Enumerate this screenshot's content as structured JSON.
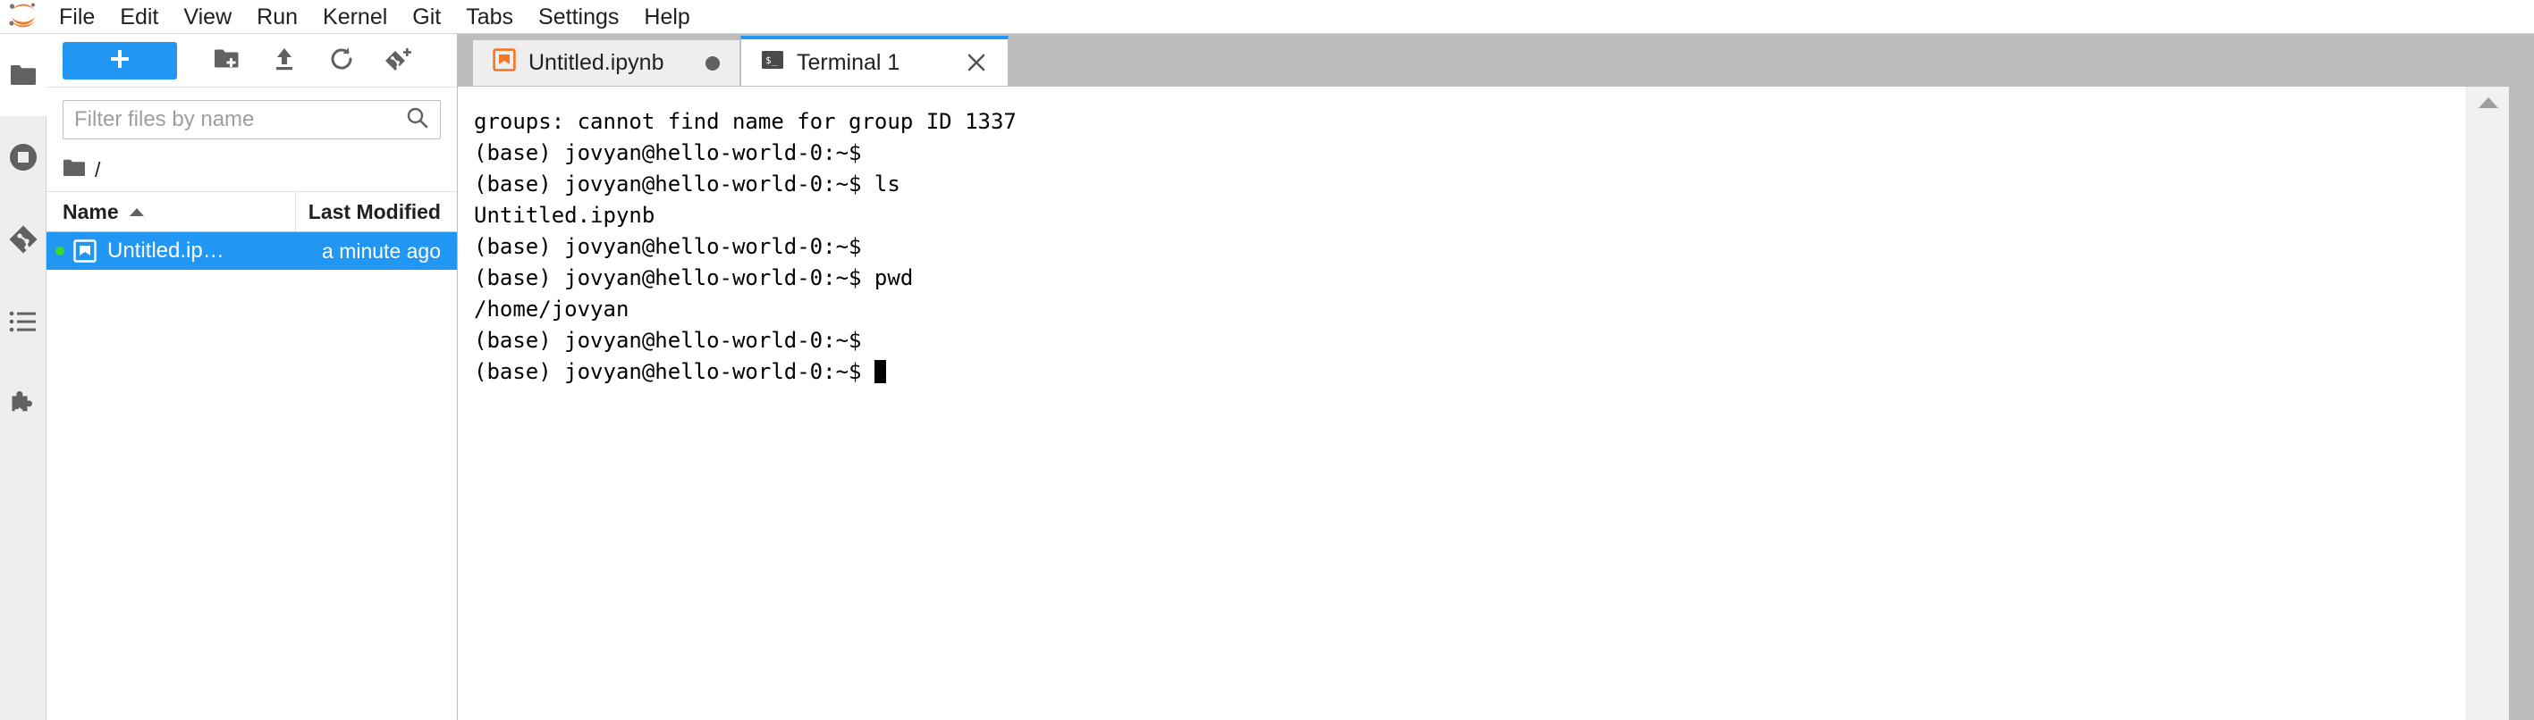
{
  "app": {
    "title": "JupyterLab",
    "logo_icon": "jupyter-logo-icon"
  },
  "menubar": {
    "items": [
      {
        "label": "File"
      },
      {
        "label": "Edit"
      },
      {
        "label": "View"
      },
      {
        "label": "Run"
      },
      {
        "label": "Kernel"
      },
      {
        "label": "Git"
      },
      {
        "label": "Tabs"
      },
      {
        "label": "Settings"
      },
      {
        "label": "Help"
      }
    ]
  },
  "activitybar": {
    "items": [
      {
        "name": "file-browser",
        "icon": "folder-icon",
        "active": true
      },
      {
        "name": "running-sessions",
        "icon": "stop-circle-icon",
        "active": false
      },
      {
        "name": "git",
        "icon": "git-icon",
        "active": false
      },
      {
        "name": "table-of-contents",
        "icon": "list-icon",
        "active": false
      },
      {
        "name": "extension-manager",
        "icon": "puzzle-piece-icon",
        "active": false
      }
    ]
  },
  "filebrowser": {
    "toolbar": {
      "new_launcher_icon": "plus-icon",
      "new_folder_icon": "new-folder-icon",
      "upload_icon": "upload-icon",
      "refresh_icon": "refresh-icon",
      "new_git_repo_icon": "git-clone-icon"
    },
    "filter": {
      "placeholder": "Filter files by name",
      "value": "",
      "search_icon": "search-icon"
    },
    "breadcrumb": {
      "home_icon": "folder-icon",
      "path": "/"
    },
    "columns": {
      "name": "Name",
      "last_modified": "Last Modified",
      "sort_direction": "ascending"
    },
    "rows": [
      {
        "name": "Untitled.ip…",
        "full_name": "Untitled.ipynb",
        "last_modified": "a minute ago",
        "icon": "notebook-icon",
        "selected": true,
        "running": true
      }
    ]
  },
  "tabbar": {
    "tabs": [
      {
        "label": "Untitled.ipynb",
        "icon": "notebook-icon",
        "active": false,
        "dirty": true,
        "closable": false
      },
      {
        "label": "Terminal 1",
        "icon": "terminal-icon",
        "active": true,
        "dirty": false,
        "closable": true,
        "close_icon": "close-icon"
      }
    ]
  },
  "terminal": {
    "lines": [
      "groups: cannot find name for group ID 1337",
      "(base) jovyan@hello-world-0:~$",
      "(base) jovyan@hello-world-0:~$ ls",
      "Untitled.ipynb",
      "(base) jovyan@hello-world-0:~$",
      "(base) jovyan@hello-world-0:~$ pwd",
      "/home/jovyan",
      "(base) jovyan@hello-world-0:~$",
      "(base) jovyan@hello-world-0:~$ "
    ],
    "cursor_on_last_line": true,
    "scrollbar_up_icon": "caret-up-icon"
  },
  "colors": {
    "accent_blue": "#2196f3",
    "jupyter_orange": "#f37726",
    "running_green": "#3bd832",
    "tabbar_bg": "#bdbdbd",
    "activitybar_bg": "#eeeeee"
  }
}
